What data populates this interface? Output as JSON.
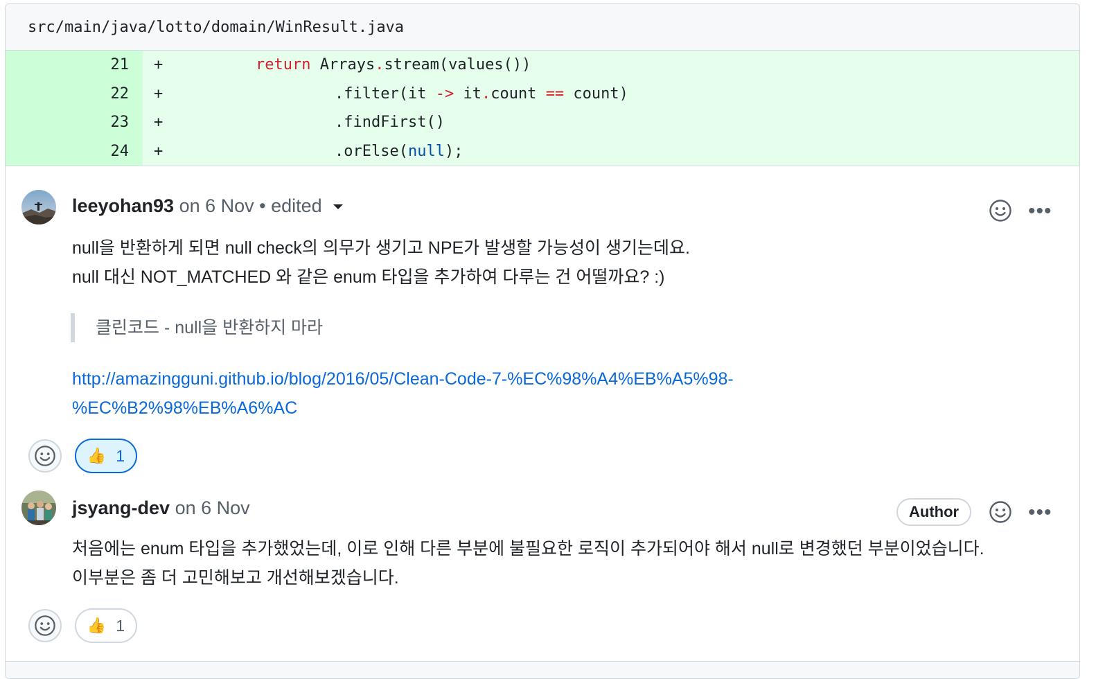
{
  "file": {
    "path": "src/main/java/lotto/domain/WinResult.java"
  },
  "diff_lines": [
    {
      "num": "21",
      "sign": "+"
    },
    {
      "num": "22",
      "sign": "+"
    },
    {
      "num": "23",
      "sign": "+"
    },
    {
      "num": "24",
      "sign": "+"
    }
  ],
  "code": {
    "l21": {
      "kw": "return",
      "rest": " Arrays",
      "dot": ".",
      "rest2": "stream(values())"
    },
    "l22": {
      "a": ".filter(it ",
      "arrow": "->",
      "b": " it",
      "dot": ".",
      "c": "count ",
      "eq": "==",
      "d": " count)"
    },
    "l23": {
      "a": ".findFirst()"
    },
    "l24": {
      "a": ".orElse(",
      "lit": "null",
      "b": ");"
    }
  },
  "comments": [
    {
      "user": "leeyohan93",
      "meta": " on 6 Nov • edited",
      "lines": [
        "null을 반환하게 되면 null check의 의무가 생기고 NPE가 발생할 가능성이 생기는데요.",
        "null 대신 NOT_MATCHED 와 같은 enum 타입을 추가하여 다루는 건 어떨까요? :)"
      ],
      "quote": "클린코드 - null을 반환하지 마라",
      "link_line1": "http://amazingguni.github.io/blog/2016/05/Clean-Code-7-%EC%98%A4%EB%A5%98-",
      "link_line2": "%EC%B2%98%EB%A6%AC",
      "reaction_count": "1",
      "reaction_emoji": "👍"
    },
    {
      "user": "jsyang-dev",
      "meta": " on 6 Nov",
      "badge": "Author",
      "lines": [
        "처음에는 enum 타입을 추가했었는데, 이로 인해 다른 부분에 불필요한 로직이 추가되어야 해서 null로 변경했던 부분이었습니다.",
        "이부분은 좀 더 고민해보고 개선해보겠습니다."
      ],
      "reaction_count": "1",
      "reaction_emoji": "👍"
    }
  ],
  "icons": {
    "smiley": "smiley-icon",
    "kebab": "kebab-horizontal-icon",
    "kebab_glyph": "•••",
    "thumbs": "thumbs-up-icon"
  }
}
